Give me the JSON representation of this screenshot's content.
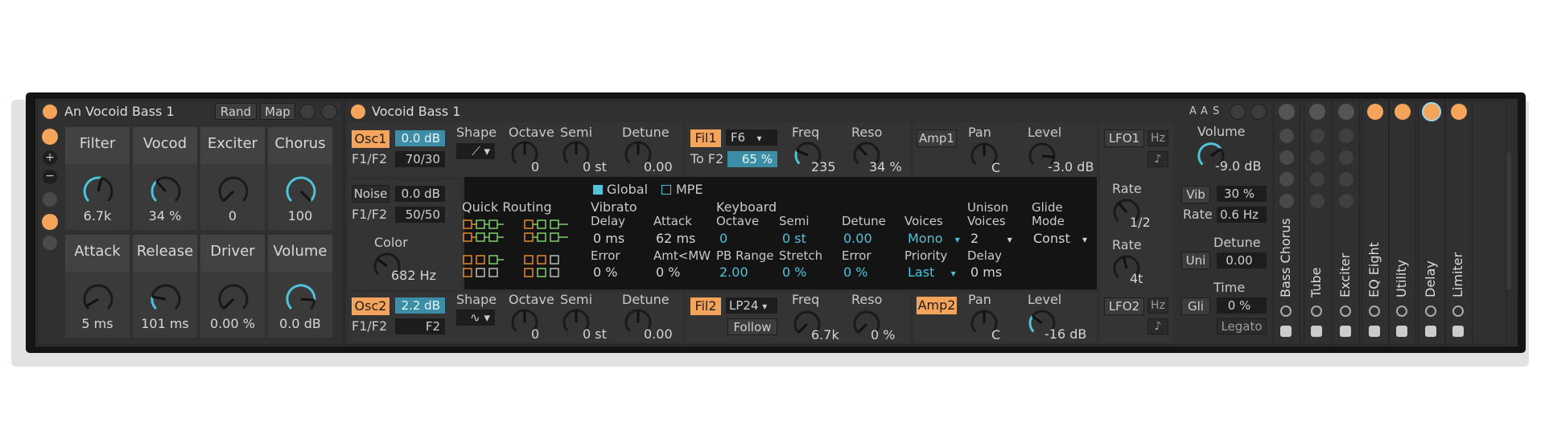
{
  "rack": {
    "title": "An Vocoid Bass 1",
    "rand_label": "Rand",
    "map_label": "Map",
    "macros": [
      {
        "name": "Filter",
        "value": "6.7k",
        "pos": 0.55,
        "active": true
      },
      {
        "name": "Vocod",
        "value": "34 %",
        "pos": 0.34,
        "active": true
      },
      {
        "name": "Exciter",
        "value": "0",
        "pos": 0.0,
        "active": false
      },
      {
        "name": "Chorus",
        "value": "100",
        "pos": 1.0,
        "active": true
      },
      {
        "name": "Attack",
        "value": "5 ms",
        "pos": 0.05,
        "active": false
      },
      {
        "name": "Release",
        "value": "101 ms",
        "pos": 0.2,
        "active": true
      },
      {
        "name": "Driver",
        "value": "0.00 %",
        "pos": 0.0,
        "active": false
      },
      {
        "name": "Volume",
        "value": "0.0 dB",
        "pos": 0.85,
        "active": true
      }
    ]
  },
  "device": {
    "title": "Vocoid Bass 1",
    "osc1": {
      "label": "Osc1",
      "level": "0.0 dB",
      "f1f2_label": "F1/F2",
      "f1f2": "70/30",
      "shape_label": "Shape",
      "octave_label": "Octave",
      "octave": "0",
      "semi_label": "Semi",
      "semi": "0 st",
      "detune_label": "Detune",
      "detune": "0.00"
    },
    "noise": {
      "label": "Noise",
      "level": "0.0 dB",
      "f1f2_label": "F1/F2",
      "f1f2": "50/50",
      "color_label": "Color",
      "color": "682 Hz"
    },
    "osc2": {
      "label": "Osc2",
      "level": "2.2 dB",
      "f1f2_label": "F1/F2",
      "f1f2": "F2",
      "shape_label": "Shape",
      "octave_label": "Octave",
      "octave": "0",
      "semi_label": "Semi",
      "semi": "0 st",
      "detune_label": "Detune",
      "detune": "0.00"
    },
    "fil1": {
      "label": "Fil1",
      "type": "F6",
      "to_label": "To F2",
      "to_value": "65 %",
      "freq_label": "Freq",
      "freq": "235",
      "reso_label": "Reso",
      "reso": "34 %"
    },
    "fil2": {
      "label": "Fil2",
      "type": "LP24",
      "follow_label": "Follow",
      "freq_label": "Freq",
      "freq": "6.7k",
      "reso_label": "Reso",
      "reso": "0 %"
    },
    "amp1": {
      "label": "Amp1",
      "pan_label": "Pan",
      "pan": "C",
      "level_label": "Level",
      "level": "-3.0 dB"
    },
    "amp2": {
      "label": "Amp2",
      "pan_label": "Pan",
      "pan": "C",
      "level_label": "Level",
      "level": "-16 dB"
    },
    "lfo1": {
      "label": "LFO1",
      "hz_label": "Hz",
      "rate_label": "Rate",
      "rate": "1/2"
    },
    "lfo2": {
      "label": "LFO2",
      "hz_label": "Hz",
      "rate_label": "Rate",
      "rate": "4t"
    },
    "global": {
      "global_label": "Global",
      "mpe_label": "MPE",
      "quick_routing_label": "Quick Routing",
      "vibrato_label": "Vibrato",
      "delay_label": "Delay",
      "delay": "0 ms",
      "attack_label": "Attack",
      "attack": "62 ms",
      "error_label": "Error",
      "error": "0 %",
      "amtmw_label": "Amt<MW",
      "amtmw": "0 %",
      "keyboard_label": "Keyboard",
      "octave_label": "Octave",
      "octave": "0",
      "semi_label": "Semi",
      "semi": "0 st",
      "detune_label": "Detune",
      "detune": "0.00",
      "pbrange_label": "PB Range",
      "pbrange": "2.00",
      "stretch_label": "Stretch",
      "stretch": "0 %",
      "kerror_label": "Error",
      "kerror": "0 %",
      "voices_label": "Voices",
      "voices": "Mono",
      "priority_label": "Priority",
      "priority": "Last",
      "unison_label": "Unison",
      "unison_voices_label": "Voices",
      "unison_voices": "2",
      "unison_delay_label": "Delay",
      "unison_delay": "0 ms",
      "glide_label": "Glide",
      "glide_mode_label": "Mode",
      "glide_mode": "Const"
    },
    "right": {
      "a_label": "A",
      "s_label": "S",
      "volume_label": "Volume",
      "volume": "-9.0 dB",
      "vib_label": "Vib",
      "vib": "30 %",
      "rate_label": "Rate",
      "rate": "0.6 Hz",
      "uni_label": "Uni",
      "detune_label": "Detune",
      "detune": "0.00",
      "gli_label": "Gli",
      "time_label": "Time",
      "time": "0 %",
      "legato_label": "Legato"
    }
  },
  "chain": [
    {
      "name": "Bass Chorus"
    },
    {
      "name": "Tube"
    },
    {
      "name": "Exciter"
    },
    {
      "name": "EQ Eight"
    },
    {
      "name": "Utility"
    },
    {
      "name": "Delay"
    },
    {
      "name": "Limiter"
    }
  ],
  "colors": {
    "accent": "#f5a55b",
    "blue": "#4fc3d9",
    "panel": "#303030",
    "dark": "#141414"
  }
}
